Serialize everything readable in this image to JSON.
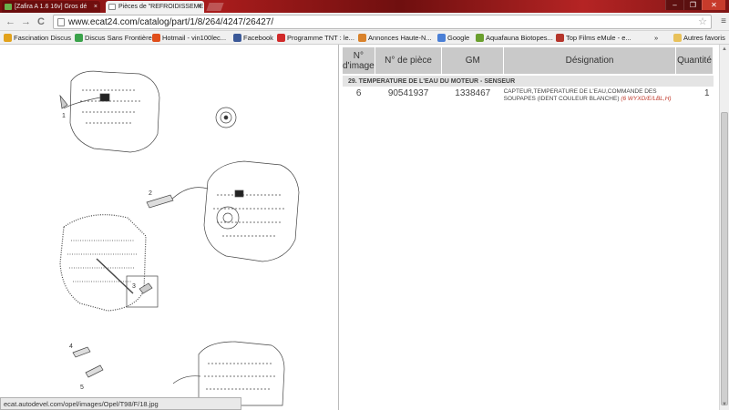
{
  "browser": {
    "tabs": [
      {
        "label": "[Zafira A 1.6 16v] Gros dé"
      },
      {
        "label": "Pièces de \"REFROIDISSEME"
      }
    ],
    "url": "www.ecat24.com/catalog/part/1/8/264/4247/26427/",
    "nav": {
      "back": "←",
      "forward": "→",
      "reload": "C"
    },
    "bookmarks": [
      {
        "label": "Fascination Discus",
        "color": "#e2a21c"
      },
      {
        "label": "Discus Sans Frontières",
        "color": "#3aa24a"
      },
      {
        "label": "Hotmail - vin100lec...",
        "color": "#e04e1a"
      },
      {
        "label": "Facebook",
        "color": "#3b5998"
      },
      {
        "label": "Programme TNT : le...",
        "color": "#d12a2a"
      },
      {
        "label": "Annonces Haute-N...",
        "color": "#d9822b"
      },
      {
        "label": "Google",
        "color": "#4a7fd6"
      },
      {
        "label": "Aquafauna Biotopes...",
        "color": "#6a9f2e"
      },
      {
        "label": "Top Films eMule - e...",
        "color": "#b5352b"
      }
    ],
    "bookmarks_more": "»",
    "other_bookmarks": "Autres favoris",
    "status_url": "ecat.autodevel.com/opel/images/Opel/T98/F/18.jpg"
  },
  "diagram_labels": [
    "1",
    "2",
    "3",
    "4",
    "5"
  ],
  "parts_table": {
    "headers": {
      "num": "N° d'image",
      "part": "N° de pièce",
      "gm": "GM",
      "designation": "Désignation",
      "qty": "Quantité"
    },
    "section": "29. TEMPERATURE DE L'EAU DU MOTEUR - SENSEUR",
    "rows": [
      {
        "num": "6",
        "part": "90541937",
        "gm": "1338467",
        "designation": "CAPTEUR,TEMPERATURE DE L'EAU,COMMANDE DES SOUPAPES (IDENT COULEUR BLANCHE)",
        "ref": "(6 WYXD/E/LBL,H)",
        "qty": "1"
      }
    ]
  }
}
